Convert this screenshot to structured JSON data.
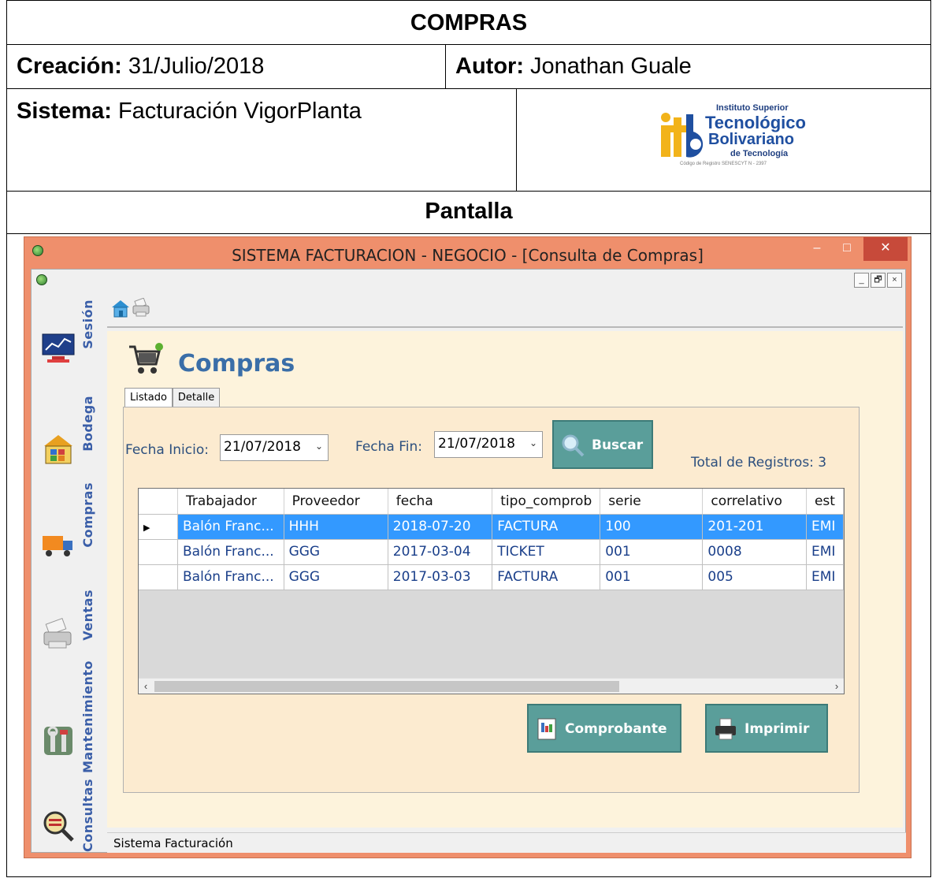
{
  "doc": {
    "title": "COMPRAS",
    "creation_label": "Creación:",
    "creation_value": " 31/Julio/2018",
    "author_label": "Autor:",
    "author_value": " Jonathan Guale",
    "system_label": "Sistema:",
    "system_value": " Facturación VigorPlanta",
    "logo": {
      "line1": "Instituto Superior",
      "line2": "Tecnológico",
      "line3": "Bolivariano",
      "line4": "de Tecnología",
      "line5": "Código de Registro SENESCYT N - 2397",
      "mark": "itb"
    },
    "screen_label": "Pantalla"
  },
  "window": {
    "title": "SISTEMA FACTURACION - NEGOCIO - [Consulta de Compras]",
    "minimize": "–",
    "maximize": "□",
    "close": "✕"
  },
  "mdi": {
    "minimize": "_",
    "restore": "🗗",
    "close": "×"
  },
  "sidebar": [
    {
      "label": "Sesión",
      "icon": "monitor-chart-icon"
    },
    {
      "label": "Bodega",
      "icon": "warehouse-icon"
    },
    {
      "label": "Compras",
      "icon": "truck-icon"
    },
    {
      "label": "Ventas",
      "icon": "printer-icon"
    },
    {
      "label": "Mantenimiento",
      "icon": "tools-icon"
    },
    {
      "label": "Consultas",
      "icon": "magnifier-icon"
    }
  ],
  "form": {
    "title": "Compras",
    "tabs": [
      "Listado",
      "Detalle"
    ],
    "fecha_inicio_label": "Fecha Inicio:",
    "fecha_inicio_value": "21/07/2018",
    "fecha_fin_label": "Fecha Fin:",
    "fecha_fin_value": "21/07/2018",
    "buscar_label": "Buscar",
    "total_label": "Total de Registros: 3",
    "comprobante_label": "Comprobante",
    "imprimir_label": "Imprimir"
  },
  "grid": {
    "columns": [
      "Trabajador",
      "Proveedor",
      "fecha",
      "tipo_comprob",
      "serie",
      "correlativo",
      "est"
    ],
    "rows": [
      [
        "Balón Franc...",
        "HHH",
        "2018-07-20",
        "FACTURA",
        "100",
        "201-201",
        "EMI"
      ],
      [
        "Balón Franc...",
        "GGG",
        "2017-03-04",
        "TICKET",
        "001",
        "0008",
        "EMI"
      ],
      [
        "Balón Franc...",
        "GGG",
        "2017-03-03",
        "FACTURA",
        "001",
        "005",
        "EMI"
      ]
    ],
    "selected_row": 0,
    "row_marker": "▶"
  },
  "status": {
    "text": "Sistema Facturación"
  },
  "colors": {
    "window_frame": "#ef8f6c",
    "form_bg": "#fdf3dc",
    "button": "#5a9e9a",
    "selection": "#3399ff",
    "title_blue": "#3a6ea8"
  }
}
